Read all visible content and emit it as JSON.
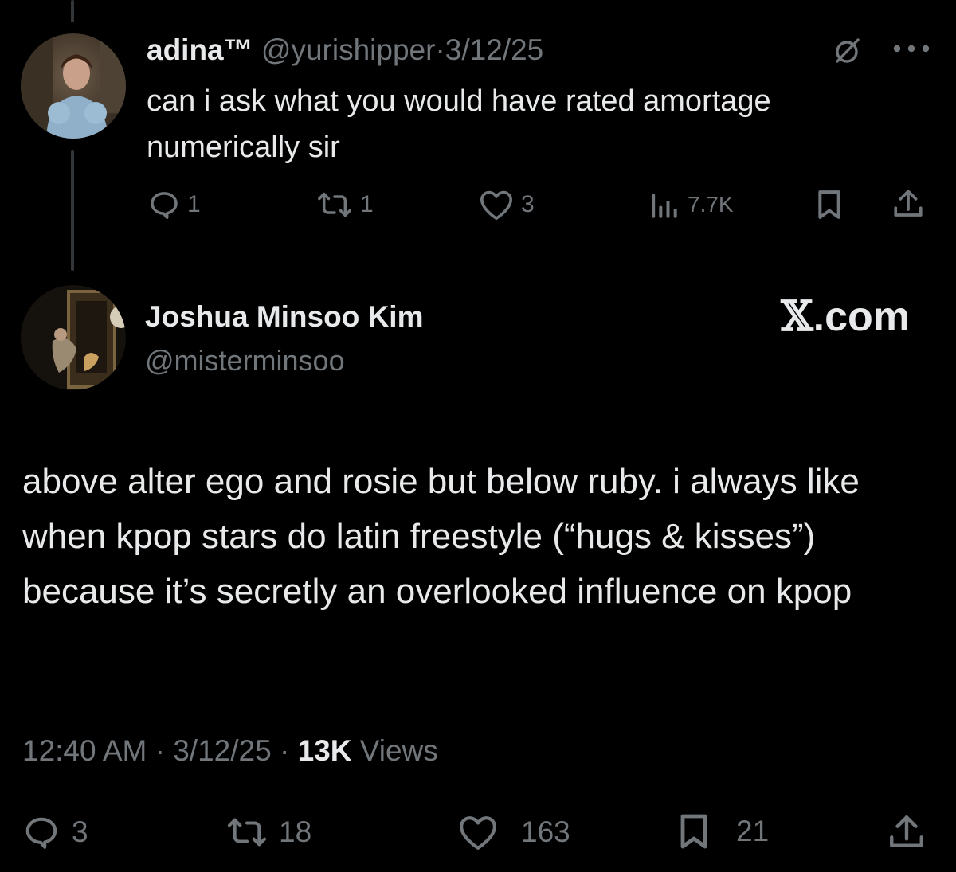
{
  "reply": {
    "display_name": "adina™",
    "handle": "@yurishipper",
    "separator": "·",
    "date": "3/12/25",
    "text": "can i ask what you would have rated amortage numerically sir",
    "stats": {
      "replies": "1",
      "reposts": "1",
      "likes": "3",
      "views": "7.7K"
    },
    "icons": [
      "grok-icon",
      "more-icon",
      "reply-icon",
      "repost-icon",
      "like-icon",
      "views-icon",
      "bookmark-icon",
      "share-icon"
    ]
  },
  "main": {
    "display_name": "Joshua Minsoo Kim",
    "handle": "@misterminsoo",
    "brand": {
      "glyph": "𝕏",
      "suffix": ".com"
    },
    "text": "above alter ego and rosie but below ruby. i always like when kpop stars do latin freestyle (“hugs & kisses”) because it’s secretly an overlooked influence on kpop",
    "time": "12:40 AM",
    "separator": "·",
    "date": "3/12/25",
    "views_count": "13K",
    "views_label": "Views",
    "stats": {
      "replies": "3",
      "reposts": "18",
      "likes": "163",
      "bookmarks": "21"
    }
  },
  "colors": {
    "background": "#000000",
    "text_primary": "#e7e9ea",
    "text_secondary": "#71767b",
    "thread_line": "#333639"
  }
}
